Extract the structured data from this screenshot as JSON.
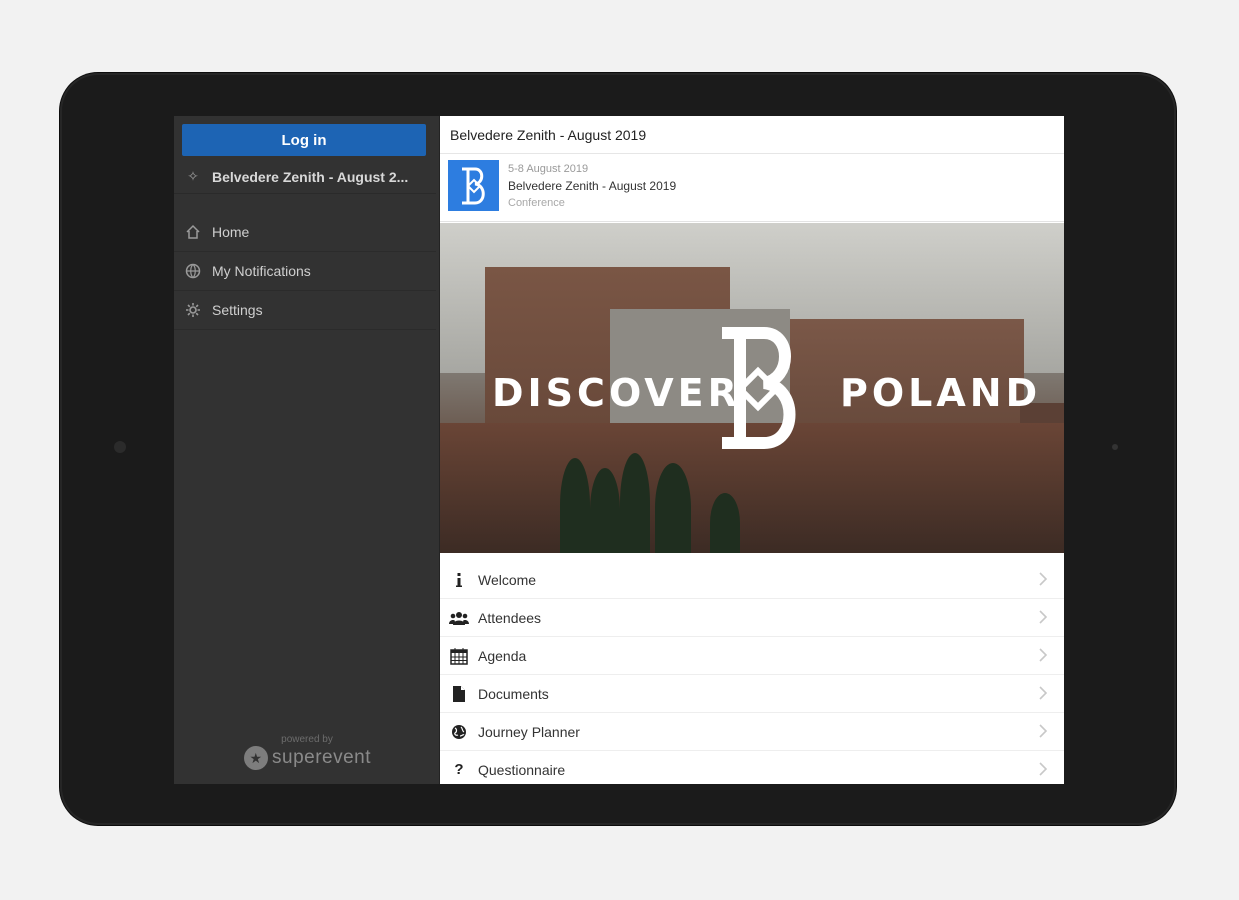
{
  "sidebar": {
    "login_label": "Log in",
    "event_name": "Belvedere Zenith - August 2...",
    "items": [
      {
        "label": "Home",
        "icon": "home-icon"
      },
      {
        "label": "My Notifications",
        "icon": "globe-icon"
      },
      {
        "label": "Settings",
        "icon": "gear-icon"
      }
    ],
    "powered_by": "powered by",
    "brand": "superevent"
  },
  "main": {
    "title": "Belvedere Zenith - August 2019",
    "event": {
      "date": "5-8 August 2019",
      "name": "Belvedere Zenith - August 2019",
      "type": "Conference",
      "logo_color": "#2d7de0"
    },
    "hero": {
      "left_text": "DISCOVER",
      "right_text": "POLAND"
    },
    "menu": [
      {
        "label": "Welcome",
        "icon": "info-icon"
      },
      {
        "label": "Attendees",
        "icon": "users-icon"
      },
      {
        "label": "Agenda",
        "icon": "calendar-icon"
      },
      {
        "label": "Documents",
        "icon": "document-icon"
      },
      {
        "label": "Journey Planner",
        "icon": "globe-icon"
      },
      {
        "label": "Questionnaire",
        "icon": "question-icon"
      }
    ]
  },
  "colors": {
    "accent": "#1d64b4",
    "sidebar_bg": "#323232"
  }
}
